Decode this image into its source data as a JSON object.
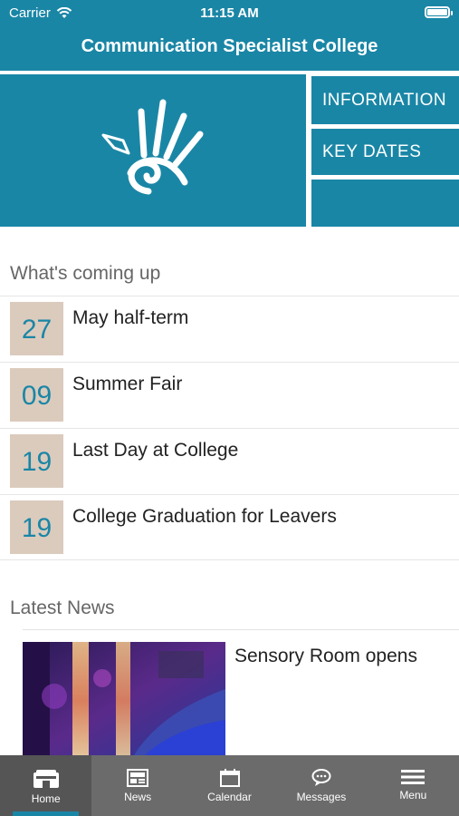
{
  "status_bar": {
    "carrier": "Carrier",
    "time": "11:15 AM"
  },
  "header": {
    "title": "Communication Specialist College"
  },
  "tiles": [
    {
      "label": "INFORMATION"
    },
    {
      "label": "KEY DATES"
    },
    {
      "label": ""
    }
  ],
  "coming_up": {
    "heading": "What's coming up",
    "events": [
      {
        "day": "27",
        "title": "May half-term"
      },
      {
        "day": "09",
        "title": "Summer Fair"
      },
      {
        "day": "19",
        "title": "Last Day at College"
      },
      {
        "day": "19",
        "title": "College Graduation for Leavers"
      }
    ]
  },
  "news": {
    "heading": "Latest News",
    "items": [
      {
        "title": "Sensory Room opens"
      }
    ]
  },
  "tabbar": {
    "tabs": [
      {
        "label": "Home",
        "icon": "home-icon",
        "active": true
      },
      {
        "label": "News",
        "icon": "news-icon"
      },
      {
        "label": "Calendar",
        "icon": "calendar-icon"
      },
      {
        "label": "Messages",
        "icon": "messages-icon"
      },
      {
        "label": "Menu",
        "icon": "menu-icon"
      }
    ]
  },
  "colors": {
    "brand": "#1a86a6",
    "date_box": "#dbcbbd",
    "tabbar": "#6b6b6b"
  }
}
